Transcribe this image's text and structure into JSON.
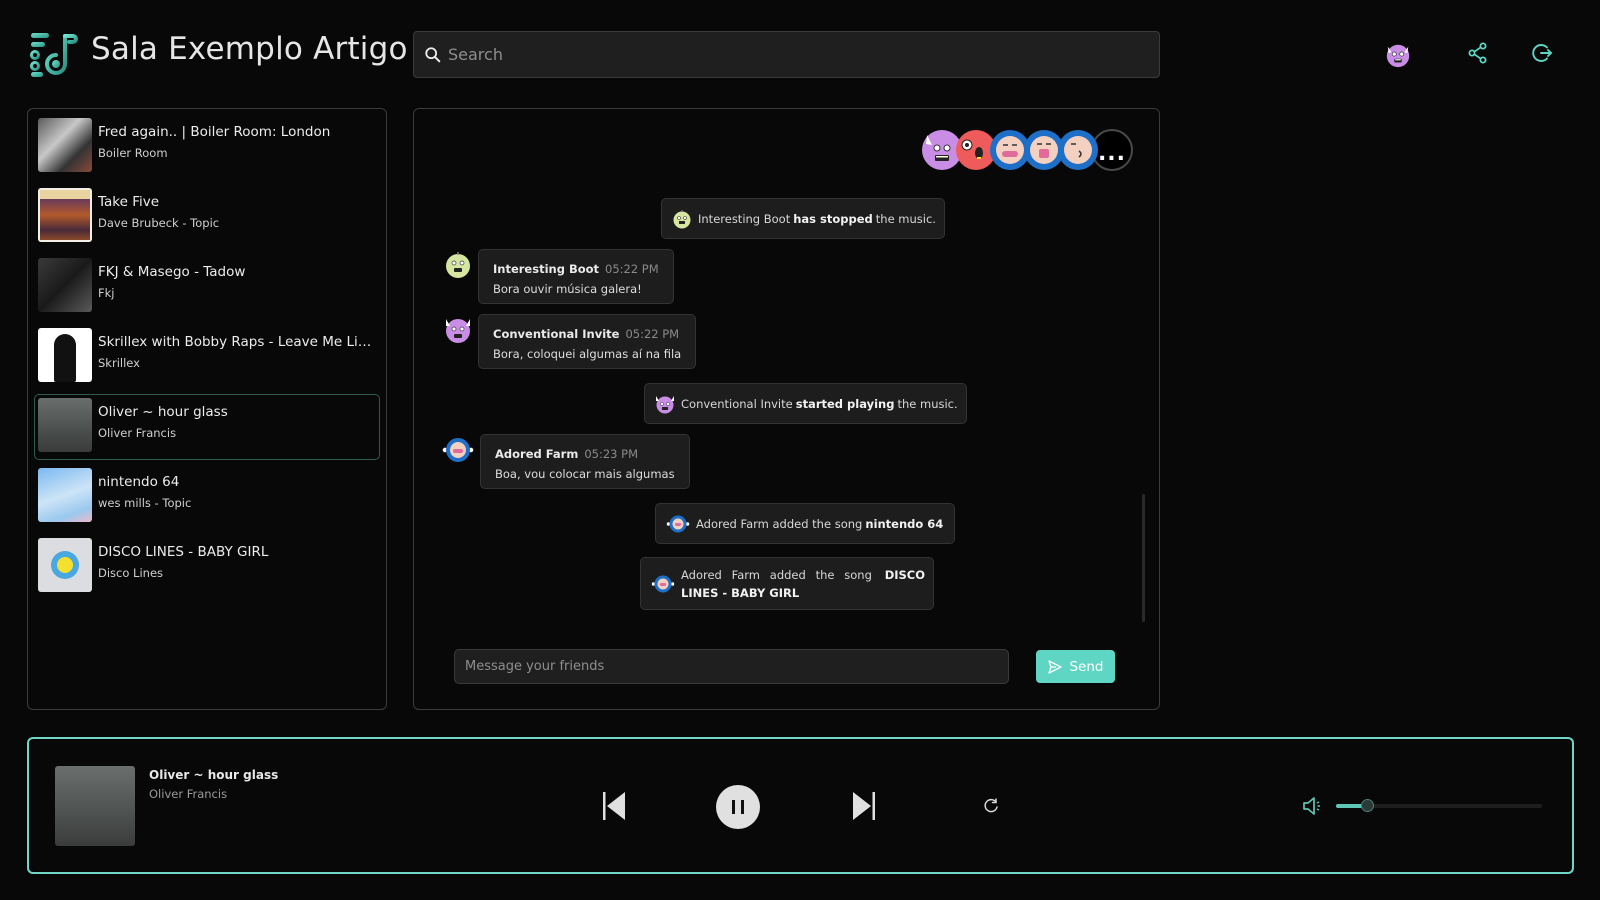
{
  "header": {
    "title": "Sala Exemplo Artigo",
    "search_placeholder": "Search",
    "icons": [
      "user-avatar",
      "share-icon",
      "logout-icon"
    ]
  },
  "colors": {
    "accent": "#5fd6c4",
    "background": "#080808",
    "panel_border": "#3b3b3b",
    "bubble_bg": "#1d1d1d"
  },
  "queue": {
    "items": [
      {
        "title": "Fred again.. | Boiler Room: London",
        "artist": "Boiler Room",
        "active": false
      },
      {
        "title": "Take Five",
        "artist": "Dave Brubeck - Topic",
        "active": false
      },
      {
        "title": "FKJ & Masego - Tadow",
        "artist": "Fkj",
        "active": false
      },
      {
        "title": "Skrillex with Bobby Raps - Leave Me Like T...",
        "artist": "Skrillex",
        "active": false
      },
      {
        "title": "Oliver ~ hour glass",
        "artist": "Oliver Francis",
        "active": true
      },
      {
        "title": "nintendo 64",
        "artist": "wes mills - Topic",
        "active": false
      },
      {
        "title": "DISCO LINES - BABY GIRL",
        "artist": "Disco Lines",
        "active": false
      }
    ]
  },
  "chat": {
    "participants": [
      "purple-devil",
      "red-creature",
      "blue-face-1",
      "blue-face-2",
      "blue-face-3"
    ],
    "more_label": "...",
    "events": [
      {
        "type": "system",
        "user": "Interesting Boot",
        "action": "has stopped",
        "suffix": "the music."
      },
      {
        "type": "message",
        "user": "Interesting Boot",
        "time": "05:22 PM",
        "text": "Bora ouvir música galera!"
      },
      {
        "type": "message",
        "user": "Conventional Invite",
        "time": "05:22 PM",
        "text": "Bora, coloquei algumas aí na fila"
      },
      {
        "type": "system",
        "user": "Conventional Invite",
        "action": "started playing",
        "suffix": "the music."
      },
      {
        "type": "message",
        "user": "Adored Farm",
        "time": "05:23 PM",
        "text": "Boa, vou colocar mais algumas"
      },
      {
        "type": "system",
        "user": "Adored Farm",
        "prefix": "added the song",
        "song": "nintendo 64"
      },
      {
        "type": "system",
        "user": "Adored Farm",
        "prefix": "added the song",
        "song": "DISCO LINES - BABY GIRL"
      }
    ],
    "input_placeholder": "Message your friends",
    "send_label": "Send"
  },
  "player": {
    "title": "Oliver ~ hour glass",
    "artist": "Oliver Francis",
    "state": "playing",
    "volume_percent": 15
  }
}
